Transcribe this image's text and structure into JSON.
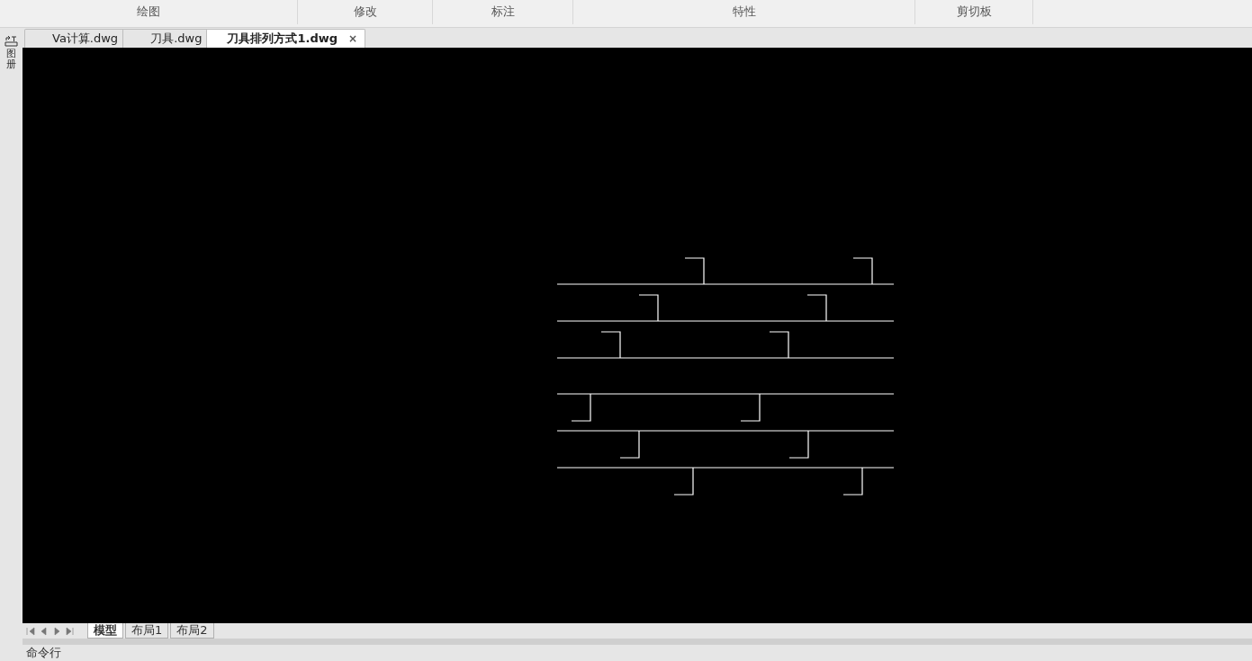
{
  "ribbon": {
    "groups": [
      {
        "label": "绘图"
      },
      {
        "label": "修改"
      },
      {
        "label": "标注"
      },
      {
        "label": "特性"
      },
      {
        "label": "剪切板"
      }
    ]
  },
  "side_toolbar": {
    "label": "图册"
  },
  "document_tabs": [
    {
      "label": "Va计算.dwg",
      "selected": false
    },
    {
      "label": "刀具.dwg",
      "selected": false
    },
    {
      "label": "刀具排列方式1.dwg",
      "selected": true,
      "close": "×"
    }
  ],
  "layout_tabs": [
    {
      "label": "模型",
      "selected": true
    },
    {
      "label": "布局1",
      "selected": false
    },
    {
      "label": "布局2",
      "selected": false
    }
  ],
  "command_line": {
    "label": "命令行"
  }
}
